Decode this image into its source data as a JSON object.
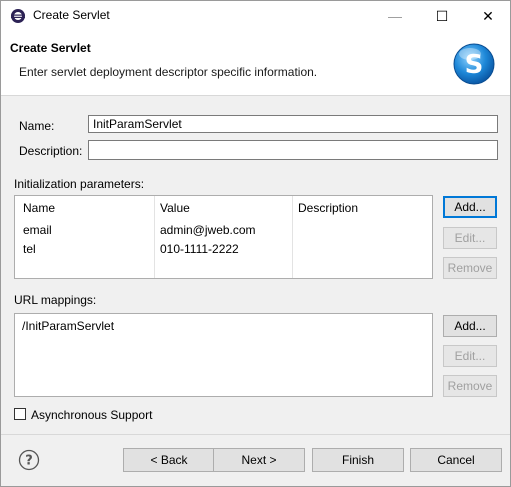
{
  "window": {
    "title": "Create Servlet",
    "minimize_glyph": "—",
    "maximize_glyph": "☐",
    "close_glyph": "✕"
  },
  "banner": {
    "title": "Create Servlet",
    "description": "Enter servlet deployment descriptor specific information.",
    "logo_letter": "S"
  },
  "form": {
    "name_label": "Name:",
    "name_value": "InitParamServlet",
    "description_label": "Description:",
    "description_value": ""
  },
  "init_params": {
    "section_label": "Initialization parameters:",
    "columns": [
      "Name",
      "Value",
      "Description"
    ],
    "rows": [
      {
        "name": "email",
        "value": "admin@jweb.com",
        "description": ""
      },
      {
        "name": "tel",
        "value": "010-1111-2222",
        "description": ""
      }
    ],
    "add_label": "Add...",
    "edit_label": "Edit...",
    "remove_label": "Remove"
  },
  "url_mappings": {
    "section_label": "URL mappings:",
    "items": [
      "/InitParamServlet"
    ],
    "add_label": "Add...",
    "edit_label": "Edit...",
    "remove_label": "Remove"
  },
  "async": {
    "label": "Asynchronous Support",
    "checked": false
  },
  "footer": {
    "help_glyph": "?",
    "back_label": "< Back",
    "next_label": "Next >",
    "finish_label": "Finish",
    "cancel_label": "Cancel"
  },
  "colors": {
    "focus_border": "#0078d7",
    "logo_blue": "#1e88d8"
  }
}
